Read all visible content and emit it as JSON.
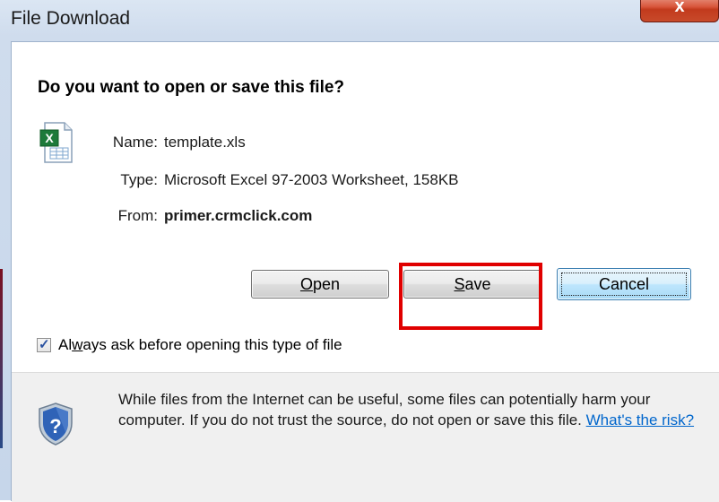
{
  "window": {
    "title": "File Download",
    "close_label": "x"
  },
  "dialog": {
    "question": "Do you want to open or save this file?",
    "file": {
      "name_label": "Name:",
      "name_value": "template.xls",
      "type_label": "Type:",
      "type_value": "Microsoft Excel 97-2003 Worksheet, 158KB",
      "from_label": "From:",
      "from_value": "primer.crmclick.com",
      "icon": "excel-file-icon"
    },
    "buttons": {
      "open_underline": "O",
      "open_rest": "pen",
      "save_underline": "S",
      "save_rest": "ave",
      "cancel": "Cancel"
    },
    "checkbox": {
      "checked": true,
      "label_pre": "Al",
      "label_underline": "w",
      "label_post": "ays ask before opening this type of file"
    },
    "warning": {
      "icon": "security-shield-question-icon",
      "text": "While files from the Internet can be useful, some files can potentially harm your computer. If you do not trust the source, do not open or save this file.",
      "link": "What's the risk?"
    }
  },
  "colors": {
    "highlight": "#e00000",
    "link": "#0066cc",
    "close_button": "#c23a1d"
  }
}
